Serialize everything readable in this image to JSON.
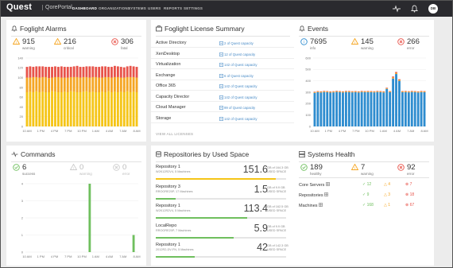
{
  "header": {
    "logo": "Quest",
    "portal": "QorePortal",
    "nav": [
      "DASHBOARD",
      "ORGANIZATIONS",
      "SYSTEMS",
      "USERS",
      "REPORTS",
      "SETTINGS"
    ],
    "avatar": "DB"
  },
  "foglight_alarms": {
    "title": "Foglight Alarms",
    "stats": [
      {
        "value": "915",
        "label": "warning"
      },
      {
        "value": "216",
        "label": "critical"
      },
      {
        "value": "306",
        "label": "fatal"
      }
    ]
  },
  "license": {
    "title": "Foglight License Summary",
    "rows": [
      {
        "name": "Active Directory",
        "value": "2 of Quest capacity"
      },
      {
        "name": "XenDesktop",
        "value": "12 of Quest capacity"
      },
      {
        "name": "Virtualization",
        "value": "142 of Quest capacity"
      },
      {
        "name": "Exchange",
        "value": "6 of Quest capacity"
      },
      {
        "name": "Office 365",
        "value": "142 of Quest capacity"
      },
      {
        "name": "Capacity Director",
        "value": "142 of Quest capacity"
      },
      {
        "name": "Cloud Manager",
        "value": "99 of Quest capacity"
      },
      {
        "name": "Storage",
        "value": "142 of Quest capacity"
      }
    ],
    "view_all": "VIEW ALL LICENSES"
  },
  "events": {
    "title": "Events",
    "stats": [
      {
        "value": "7695",
        "label": "info"
      },
      {
        "value": "145",
        "label": "warning"
      },
      {
        "value": "266",
        "label": "error"
      }
    ]
  },
  "commands": {
    "title": "Commands",
    "stats": [
      {
        "value": "6",
        "label": "success"
      },
      {
        "value": "0",
        "label": "warning"
      },
      {
        "value": "0",
        "label": "error"
      }
    ]
  },
  "repositories": {
    "title": "Repositories by Used Space",
    "items": [
      {
        "name": "Repository 1",
        "sub": "W2K12R2V4, 5 Machines",
        "value": "151.6",
        "of": "GB of 164.3 GB",
        "used": "USED SPACE",
        "pct": 92,
        "color": "#f5c518"
      },
      {
        "name": "Repository 3",
        "sub": "RROORE20P, 17 Machines",
        "value": "1.5",
        "of": "GB of 9.9 GB",
        "used": "USED SPACE",
        "pct": 15,
        "color": "#6fbf5e"
      },
      {
        "name": "Repository 1",
        "sub": "W2K12R2V4, 5 Machines",
        "value": "113.4",
        "of": "GB of 162.5 GB",
        "used": "USED SPACE",
        "pct": 70,
        "color": "#6fbf5e"
      },
      {
        "name": "LocalRepo",
        "sub": "RROORE20P, 7 Machines",
        "value": "5.9",
        "of": "GB of 9.9 GB",
        "used": "USED SPACE",
        "pct": 60,
        "color": "#6fbf5e"
      },
      {
        "name": "Repository 1",
        "sub": "2012R2-DV-FN, 5 Machines",
        "value": "42",
        "of": "GB of 142.3 GB",
        "used": "USED SPACE",
        "pct": 30,
        "color": "#6fbf5e"
      }
    ]
  },
  "systems_health": {
    "title": "Systems Health",
    "stats": [
      {
        "value": "189",
        "label": "healthy"
      },
      {
        "value": "7",
        "label": "warning"
      },
      {
        "value": "92",
        "label": "error"
      }
    ],
    "rows": [
      {
        "name": "Core Servers",
        "healthy": "12",
        "warning": "4",
        "error": "7"
      },
      {
        "name": "Repositories",
        "healthy": "9",
        "warning": "3",
        "error": "18"
      },
      {
        "name": "Machines",
        "healthy": "168",
        "warning": "1",
        "error": "67"
      }
    ]
  },
  "colors": {
    "warning": "#f5a623",
    "critical": "#f5c518",
    "fatal": "#e8534a",
    "info": "#2e8ccf",
    "success": "#6fbf5e",
    "topbar": "#2a2a2e"
  },
  "chart_data": [
    {
      "type": "bar",
      "title": "Foglight Alarms",
      "stacked": true,
      "x_tick_labels": [
        "10 AM",
        "1 PM",
        "4 PM",
        "7 PM",
        "10 PM",
        "1 AM",
        "4 AM",
        "7 AM",
        "8 AM"
      ],
      "y_tick_labels": [
        "0",
        "20",
        "40",
        "60",
        "80",
        "100",
        "120",
        "140"
      ],
      "ylim": [
        0,
        140
      ],
      "bar_count": 36,
      "series": [
        {
          "color": "#f5c518",
          "values": [
            70,
            71,
            70,
            72,
            70,
            71,
            70,
            70,
            72,
            71,
            70,
            70,
            71,
            70,
            72,
            71,
            70,
            70,
            71,
            72,
            70,
            71,
            70,
            70,
            71,
            70,
            72,
            70,
            71,
            70,
            71,
            70,
            72,
            70,
            71,
            70
          ]
        },
        {
          "color": "#f5a623",
          "values": [
            30,
            29,
            31,
            29,
            30,
            30,
            31,
            29,
            28,
            30,
            31,
            30,
            29,
            30,
            29,
            30,
            31,
            30,
            30,
            29,
            30,
            30,
            31,
            30,
            29,
            31,
            29,
            30,
            30,
            31,
            29,
            30,
            29,
            31,
            30,
            30
          ]
        },
        {
          "color": "#e8534a",
          "values": [
            22,
            23,
            21,
            22,
            23,
            22,
            21,
            23,
            22,
            22,
            21,
            23,
            22,
            22,
            21,
            22,
            23,
            22,
            21,
            22,
            23,
            22,
            21,
            22,
            23,
            22,
            21,
            22,
            23,
            22,
            22,
            21,
            22,
            23,
            22,
            22
          ]
        }
      ]
    },
    {
      "type": "bar",
      "title": "Events",
      "stacked": true,
      "x_tick_labels": [
        "10 AM",
        "1 PM",
        "4 PM",
        "7 PM",
        "10 PM",
        "1 AM",
        "4 AM",
        "7 AM",
        "8 AM"
      ],
      "y_tick_labels": [
        "0",
        "100",
        "200",
        "300",
        "400",
        "500",
        "600"
      ],
      "ylim": [
        0,
        600
      ],
      "bar_count": 36,
      "series": [
        {
          "color": "#2e8ccf",
          "values": [
            295,
            300,
            298,
            302,
            300,
            297,
            299,
            303,
            300,
            298,
            302,
            301,
            299,
            300,
            298,
            302,
            300,
            301,
            300,
            299,
            302,
            300,
            298,
            330,
            300,
            420,
            460,
            400,
            300,
            301,
            299,
            302,
            300,
            298,
            301,
            300
          ]
        },
        {
          "color": "#f5a623",
          "values": [
            6,
            6,
            6,
            6,
            6,
            6,
            6,
            6,
            6,
            6,
            6,
            6,
            6,
            6,
            6,
            6,
            6,
            6,
            6,
            6,
            6,
            6,
            6,
            6,
            6,
            10,
            10,
            8,
            6,
            6,
            6,
            6,
            6,
            6,
            6,
            6
          ]
        },
        {
          "color": "#e8534a",
          "values": [
            4,
            4,
            4,
            4,
            4,
            4,
            4,
            4,
            4,
            4,
            4,
            4,
            4,
            4,
            4,
            4,
            4,
            4,
            4,
            4,
            4,
            4,
            4,
            4,
            4,
            8,
            8,
            6,
            4,
            4,
            4,
            4,
            4,
            4,
            4,
            4
          ]
        }
      ]
    },
    {
      "type": "bar",
      "title": "Commands",
      "x_tick_labels": [
        "10 AM",
        "1 PM",
        "4 PM",
        "7 PM",
        "10 PM",
        "1 AM",
        "4 AM",
        "7 AM",
        "8 AM"
      ],
      "y_tick_labels": [
        "0",
        "1",
        "2",
        "3",
        "4"
      ],
      "ylim": [
        0,
        4
      ],
      "bar_count": 36,
      "series": [
        {
          "color": "#6fbf5e",
          "values": [
            0,
            0,
            0,
            0,
            0,
            0,
            0,
            0,
            0,
            0,
            0,
            0,
            0,
            0,
            0,
            0,
            0,
            0,
            0,
            0,
            4,
            0,
            0,
            0,
            0,
            0,
            0,
            0,
            0,
            0,
            0,
            0,
            0,
            0,
            1,
            0
          ]
        }
      ]
    }
  ]
}
